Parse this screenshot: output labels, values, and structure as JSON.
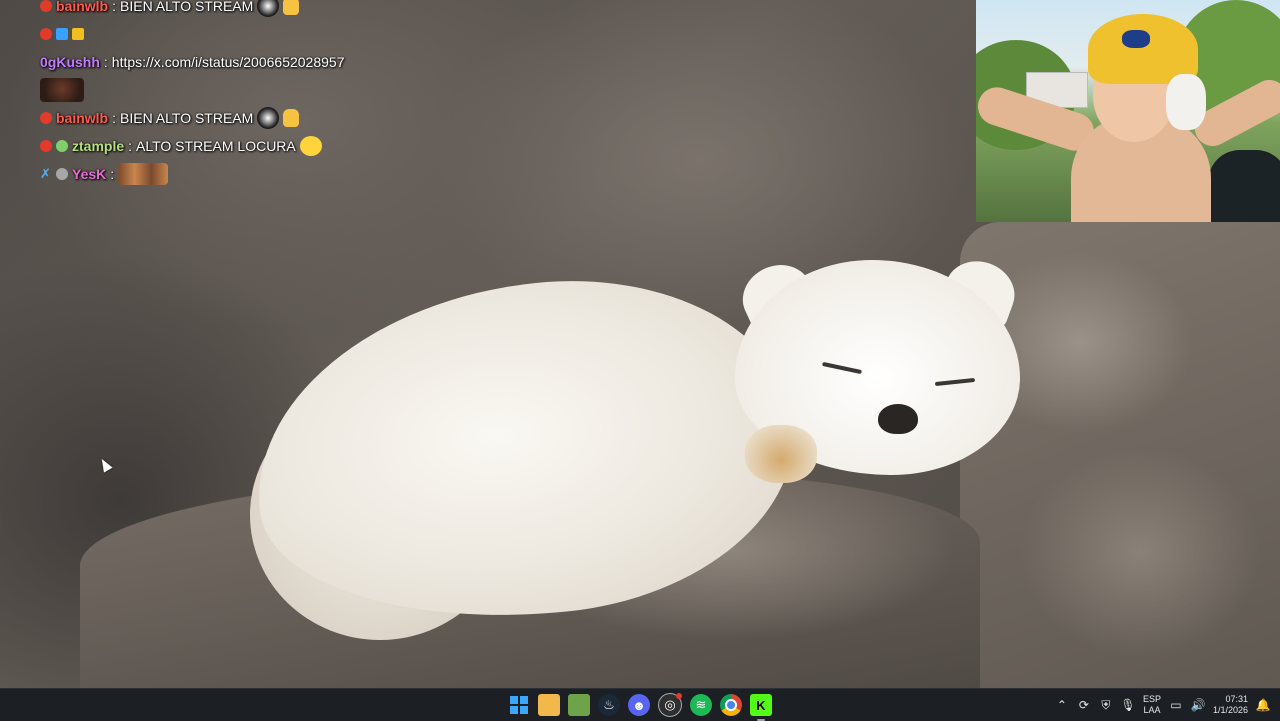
{
  "chat": {
    "messages": [
      {
        "user": "bainwlb",
        "text": "BIEN ALTO STREAM",
        "user_color": "#ff5a4a"
      },
      {
        "user": "",
        "text": "",
        "user_color": "#ffffff"
      },
      {
        "user": "0gKushh",
        "text": "https://x.com/i/status/2006652028957",
        "user_color": "#c37cff"
      },
      {
        "user": "",
        "text": "",
        "user_color": "#ffffff"
      },
      {
        "user": "bainwlb",
        "text": "BIEN ALTO STREAM",
        "user_color": "#ff5a4a"
      },
      {
        "user": "ztample",
        "text": "ALTO STREAM LOCURA",
        "user_color": "#b5e07a"
      },
      {
        "user": "YesK",
        "text": "",
        "user_color": "#e86bd7"
      }
    ]
  },
  "taskbar": {
    "apps": [
      "start-icon",
      "file-explorer-icon",
      "minecraft-icon",
      "steam-icon",
      "discord-icon",
      "obs-icon",
      "spotify-icon",
      "chrome-icon",
      "kick-icon"
    ],
    "tray": {
      "language_top": "ESP",
      "language_bottom": "LAA",
      "time": "07:31",
      "date": "1/1/2026"
    }
  },
  "colors": {
    "taskbar_bg": "#1c1f24",
    "accent": "#3ba7ff"
  }
}
